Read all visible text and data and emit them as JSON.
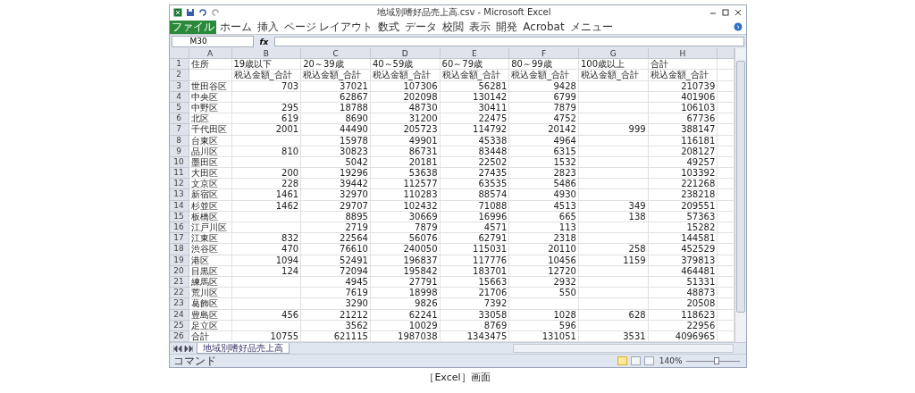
{
  "window": {
    "title": "地域別嗜好品売上高.csv - Microsoft Excel"
  },
  "ribbon_tabs": [
    {
      "label": "ファイル",
      "kind": "file"
    },
    {
      "label": "ホーム",
      "kind": "tab"
    },
    {
      "label": "挿入",
      "kind": "tab"
    },
    {
      "label": "ページ レイアウト",
      "kind": "tab"
    },
    {
      "label": "数式",
      "kind": "tab"
    },
    {
      "label": "データ",
      "kind": "tab"
    },
    {
      "label": "校閲",
      "kind": "tab"
    },
    {
      "label": "表示",
      "kind": "tab"
    },
    {
      "label": "開発",
      "kind": "tab"
    },
    {
      "label": "Acrobat",
      "kind": "tab"
    },
    {
      "label": "メニュー",
      "kind": "tab"
    }
  ],
  "name_box": "M30",
  "formula_label": "fx",
  "columns": [
    "A",
    "B",
    "C",
    "D",
    "E",
    "F",
    "G",
    "H"
  ],
  "rows": [
    {
      "number": "1",
      "kind": "header",
      "cells": [
        "住所",
        "19歳以下",
        "20～39歳",
        "40～59歳",
        "60～79歳",
        "80～99歳",
        "100歳以上",
        "合計"
      ]
    },
    {
      "number": "2",
      "kind": "header",
      "cells": [
        null,
        "税込金額_合計",
        "税込金額_合計",
        "税込金額_合計",
        "税込金額_合計",
        "税込金額_合計",
        "税込金額_合計",
        "税込金額_合計"
      ]
    },
    {
      "number": "3",
      "kind": "data",
      "cells": [
        "世田谷区",
        "703",
        "37021",
        "107306",
        "56281",
        "9428",
        null,
        "210739"
      ]
    },
    {
      "number": "4",
      "kind": "data",
      "cells": [
        "中央区",
        null,
        "62867",
        "202098",
        "130142",
        "6799",
        null,
        "401906"
      ]
    },
    {
      "number": "5",
      "kind": "data",
      "cells": [
        "中野区",
        "295",
        "18788",
        "48730",
        "30411",
        "7879",
        null,
        "106103"
      ]
    },
    {
      "number": "6",
      "kind": "data",
      "cells": [
        "北区",
        "619",
        "8690",
        "31200",
        "22475",
        "4752",
        null,
        "67736"
      ]
    },
    {
      "number": "7",
      "kind": "data",
      "cells": [
        "千代田区",
        "2001",
        "44490",
        "205723",
        "114792",
        "20142",
        "999",
        "388147"
      ]
    },
    {
      "number": "8",
      "kind": "data",
      "cells": [
        "台東区",
        null,
        "15978",
        "49901",
        "45338",
        "4964",
        null,
        "116181"
      ]
    },
    {
      "number": "9",
      "kind": "data",
      "cells": [
        "品川区",
        "810",
        "30823",
        "86731",
        "83448",
        "6315",
        null,
        "208127"
      ]
    },
    {
      "number": "10",
      "kind": "data",
      "cells": [
        "墨田区",
        null,
        "5042",
        "20181",
        "22502",
        "1532",
        null,
        "49257"
      ]
    },
    {
      "number": "11",
      "kind": "data",
      "cells": [
        "大田区",
        "200",
        "19296",
        "53638",
        "27435",
        "2823",
        null,
        "103392"
      ]
    },
    {
      "number": "12",
      "kind": "data",
      "cells": [
        "文京区",
        "228",
        "39442",
        "112577",
        "63535",
        "5486",
        null,
        "221268"
      ]
    },
    {
      "number": "13",
      "kind": "data",
      "cells": [
        "新宿区",
        "1461",
        "32970",
        "110283",
        "88574",
        "4930",
        null,
        "238218"
      ]
    },
    {
      "number": "14",
      "kind": "data",
      "cells": [
        "杉並区",
        "1462",
        "29707",
        "102432",
        "71088",
        "4513",
        "349",
        "209551"
      ]
    },
    {
      "number": "15",
      "kind": "data",
      "cells": [
        "板橋区",
        null,
        "8895",
        "30669",
        "16996",
        "665",
        "138",
        "57363"
      ]
    },
    {
      "number": "16",
      "kind": "data",
      "cells": [
        "江戸川区",
        null,
        "2719",
        "7879",
        "4571",
        "113",
        null,
        "15282"
      ]
    },
    {
      "number": "17",
      "kind": "data",
      "cells": [
        "江東区",
        "832",
        "22564",
        "56076",
        "62791",
        "2318",
        null,
        "144581"
      ]
    },
    {
      "number": "18",
      "kind": "data",
      "cells": [
        "渋谷区",
        "470",
        "76610",
        "240050",
        "115031",
        "20110",
        "258",
        "452529"
      ]
    },
    {
      "number": "19",
      "kind": "data",
      "cells": [
        "港区",
        "1094",
        "52491",
        "196837",
        "117776",
        "10456",
        "1159",
        "379813"
      ]
    },
    {
      "number": "20",
      "kind": "data",
      "cells": [
        "目黒区",
        "124",
        "72094",
        "195842",
        "183701",
        "12720",
        null,
        "464481"
      ]
    },
    {
      "number": "21",
      "kind": "data",
      "cells": [
        "練馬区",
        null,
        "4945",
        "27791",
        "15663",
        "2932",
        null,
        "51331"
      ]
    },
    {
      "number": "22",
      "kind": "data",
      "cells": [
        "荒川区",
        null,
        "7619",
        "18998",
        "21706",
        "550",
        null,
        "48873"
      ]
    },
    {
      "number": "23",
      "kind": "data",
      "cells": [
        "葛飾区",
        null,
        "3290",
        "9826",
        "7392",
        null,
        null,
        "20508"
      ]
    },
    {
      "number": "24",
      "kind": "data",
      "cells": [
        "豊島区",
        "456",
        "21212",
        "62241",
        "33058",
        "1028",
        "628",
        "118623"
      ]
    },
    {
      "number": "25",
      "kind": "data",
      "cells": [
        "足立区",
        null,
        "3562",
        "10029",
        "8769",
        "596",
        null,
        "22956"
      ]
    },
    {
      "number": "26",
      "kind": "data",
      "cells": [
        "合計",
        "10755",
        "621115",
        "1987038",
        "1343475",
        "131051",
        "3531",
        "4096965"
      ]
    }
  ],
  "sheet_tabs": [
    {
      "label": "地域別嗜好品売上高",
      "selected": true
    }
  ],
  "status_bar": {
    "mode": "コマンド",
    "zoom": "140%",
    "level": 0.55,
    "views": [
      {
        "selected": true
      },
      {
        "selected": false
      },
      {
        "selected": false
      }
    ]
  },
  "caption": "［Excel］画面"
}
